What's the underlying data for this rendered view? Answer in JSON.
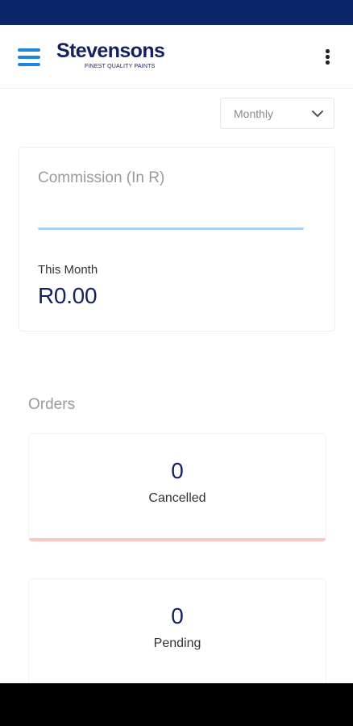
{
  "colors": {
    "status_bar": "#0d2667",
    "brand_navy": "#14215f",
    "accent_blue": "#1f86e0",
    "cancelled_accent": "#f6c7c5"
  },
  "header": {
    "menu_icon": "hamburger-menu-icon",
    "brand_name": "Stevensons",
    "brand_tagline": "FINEST QUALITY PAINTS",
    "overflow_icon": "more-vertical-icon"
  },
  "filter": {
    "selected": "Monthly",
    "icon": "chevron-down-icon"
  },
  "commission": {
    "title": "Commission (In R)",
    "period_label": "This Month",
    "value": "R0.00"
  },
  "orders": {
    "heading": "Orders",
    "cards": [
      {
        "count": "0",
        "label": "Cancelled"
      },
      {
        "count": "0",
        "label": "Pending"
      }
    ]
  }
}
